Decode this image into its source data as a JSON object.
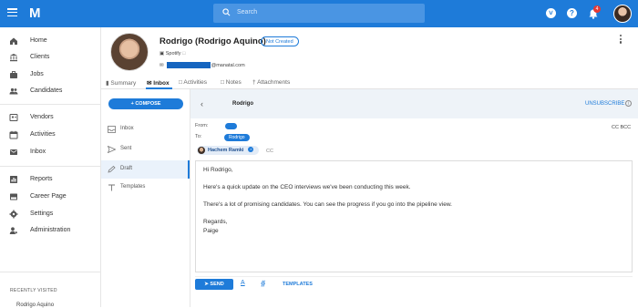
{
  "topbar": {
    "logo": "M",
    "search_placeholder": "Search",
    "notification_count": "4"
  },
  "sidebar": {
    "items": [
      {
        "label": "Home",
        "icon": "home-icon"
      },
      {
        "label": "Clients",
        "icon": "bank-icon"
      },
      {
        "label": "Jobs",
        "icon": "briefcase-icon"
      },
      {
        "label": "Candidates",
        "icon": "people-icon"
      },
      {
        "label": "Vendors",
        "icon": "vendor-icon"
      },
      {
        "label": "Activities",
        "icon": "calendar-icon"
      },
      {
        "label": "Inbox",
        "icon": "mail-icon"
      },
      {
        "label": "Reports",
        "icon": "reports-icon"
      },
      {
        "label": "Career Page",
        "icon": "career-page-icon"
      },
      {
        "label": "Settings",
        "icon": "gear-icon"
      },
      {
        "label": "Administration",
        "icon": "admin-icon"
      }
    ],
    "recent_title": "RECENTLY VISITED",
    "recent_items": [
      "Rodrigo Aquino"
    ]
  },
  "profile": {
    "name": "Rodrigo (Rodrigo Aquino)",
    "status": "Not Created",
    "company": "Spotify",
    "email_domain": "@manatal.com"
  },
  "tabs": [
    {
      "label": "Summary",
      "active": false
    },
    {
      "label": "Inbox",
      "active": true
    },
    {
      "label": "Activities",
      "active": false
    },
    {
      "label": "Notes",
      "active": false
    },
    {
      "label": "Attachments",
      "active": false
    }
  ],
  "mail": {
    "compose_label": "COMPOSE",
    "folders": [
      {
        "label": "Inbox",
        "active": false
      },
      {
        "label": "Sent",
        "active": false
      },
      {
        "label": "Draft",
        "active": true
      },
      {
        "label": "Templates",
        "active": false
      }
    ],
    "thread_name": "Rodrigo",
    "unsubscribe_label": "UNSUBSCRIBE",
    "from_label": "From:",
    "to_label": "To:",
    "to_value": "Rodrigo",
    "cc_bcc_label": "CC BCC",
    "recipient": "Hachem Ramki",
    "cc_label": "CC",
    "body": {
      "greeting": "Hi Rodrigo,",
      "line1": "Here's a quick update on the CEO interviews we've been conducting this week.",
      "line2": "There's a lot of promising candidates. You can see the progress if you go into the pipeline view.",
      "signoff": "Regards,",
      "signature": "Paige"
    },
    "send_label": "SEND",
    "templates_label": "TEMPLATES"
  },
  "colors": {
    "accent": "#1e7bd9",
    "badge": "#e53935"
  }
}
